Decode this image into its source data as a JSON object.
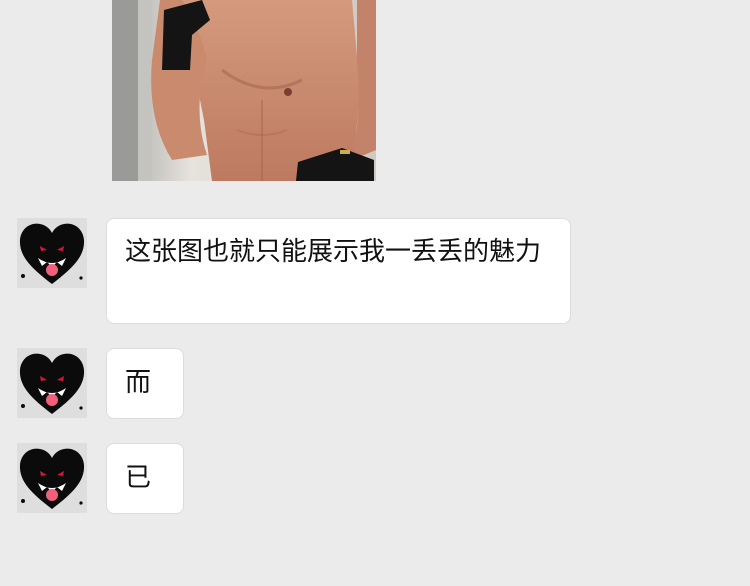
{
  "chat": {
    "messages": [
      {
        "text": "这张图也就只能展示我一丢丢的魅力",
        "sender": "other",
        "avatar_icon": "black-heart-monster-icon"
      },
      {
        "text": "而",
        "sender": "other",
        "avatar_icon": "black-heart-monster-icon"
      },
      {
        "text": "已",
        "sender": "other",
        "avatar_icon": "black-heart-monster-icon"
      }
    ],
    "photo_icon": "shirtless-man-photo"
  },
  "colors": {
    "background": "#ebebeb",
    "bubble": "#ffffff",
    "heart": "#0b0b0b",
    "eyes": "#d6153a",
    "tongue": "#f0607a"
  }
}
